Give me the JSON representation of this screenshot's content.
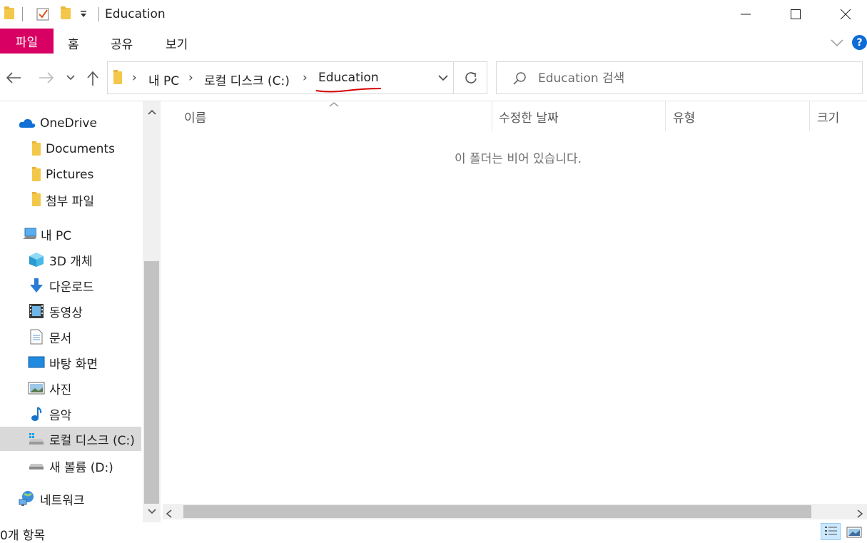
{
  "window": {
    "title": "Education",
    "minimize_label": "—",
    "maximize_label": "☐",
    "close_label": "✕"
  },
  "ribbon": {
    "tabs": [
      "파일",
      "홈",
      "공유",
      "보기"
    ],
    "active_color": "#d80062"
  },
  "address": {
    "crumbs": [
      "내 PC",
      "로컬 디스크 (C:)",
      "Education"
    ],
    "separator": "›"
  },
  "search": {
    "placeholder": "Education 검색"
  },
  "nav": {
    "items": [
      {
        "label": "OneDrive",
        "icon": "onedrive-icon"
      },
      {
        "label": "Documents",
        "icon": "folder-icon"
      },
      {
        "label": "Pictures",
        "icon": "folder-icon"
      },
      {
        "label": "첨부 파일",
        "icon": "folder-icon"
      },
      {
        "label": "내 PC",
        "icon": "computer-icon"
      },
      {
        "label": "3D 개체",
        "icon": "3d-objects-icon"
      },
      {
        "label": "다운로드",
        "icon": "download-icon"
      },
      {
        "label": "동영상",
        "icon": "video-icon"
      },
      {
        "label": "문서",
        "icon": "document-icon"
      },
      {
        "label": "바탕 화면",
        "icon": "desktop-icon"
      },
      {
        "label": "사진",
        "icon": "pictures-icon"
      },
      {
        "label": "음악",
        "icon": "music-icon"
      },
      {
        "label": "로컬 디스크 (C:)",
        "icon": "local-disk-icon"
      },
      {
        "label": "새 볼륨 (D:)",
        "icon": "drive-icon"
      },
      {
        "label": "네트워크",
        "icon": "network-icon"
      }
    ],
    "selected": "로컬 디스크 (C:)"
  },
  "columns": [
    "이름",
    "수정한 날짜",
    "유형",
    "크기"
  ],
  "content": {
    "empty_message": "이 폴더는 비어 있습니다."
  },
  "status": {
    "item_count": "0개 항목"
  },
  "colors": {
    "accent": "#0078d7",
    "annotation_underline": "#d40000"
  }
}
